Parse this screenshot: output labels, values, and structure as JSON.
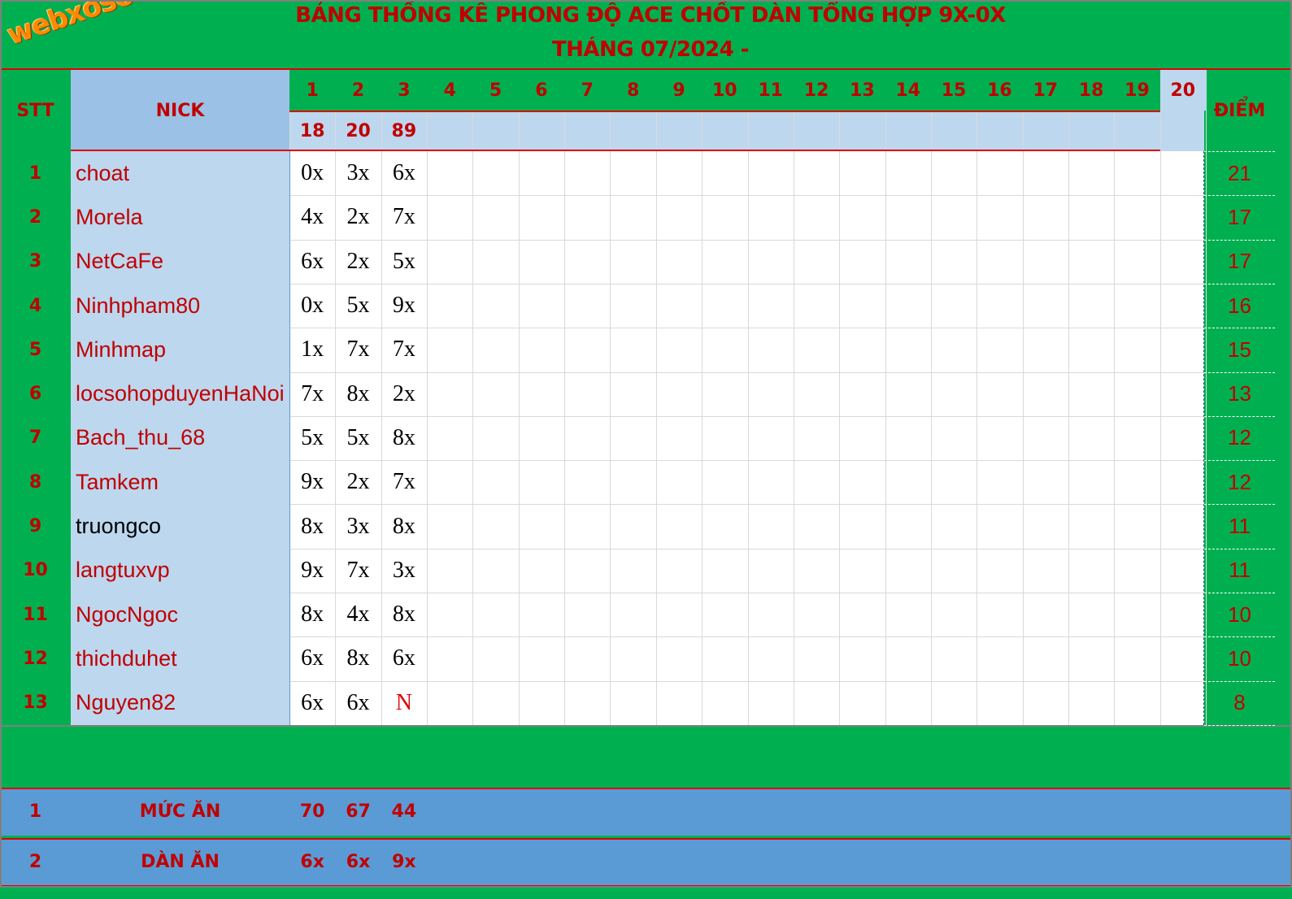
{
  "logo_text": "webxoso.net",
  "title_line1": "BẢNG THỐNG KÊ PHONG ĐỘ ACE CHỐT DÀN TỔNG HỢP 9X-0X",
  "title_line2": "THÁNG 07/2024 -",
  "headers": {
    "stt": "STT",
    "nick": "NICK",
    "score": "ĐIỂM"
  },
  "days": [
    "1",
    "2",
    "3",
    "4",
    "5",
    "6",
    "7",
    "8",
    "9",
    "10",
    "11",
    "12",
    "13",
    "14",
    "15",
    "16",
    "17",
    "18",
    "19",
    "20"
  ],
  "results": [
    "18",
    "20",
    "89"
  ],
  "rows": [
    {
      "stt": "1",
      "nick": "choat",
      "picks": [
        "0x",
        "3x",
        "6x"
      ],
      "score": "21",
      "nick_color": "#c00000"
    },
    {
      "stt": "2",
      "nick": "Morela",
      "picks": [
        "4x",
        "2x",
        "7x"
      ],
      "score": "17",
      "nick_color": "#c00000"
    },
    {
      "stt": "3",
      "nick": "NetCaFe",
      "picks": [
        "6x",
        "2x",
        "5x"
      ],
      "score": "17",
      "nick_color": "#c00000"
    },
    {
      "stt": "4",
      "nick": "Ninhpham80",
      "picks": [
        "0x",
        "5x",
        "9x"
      ],
      "score": "16",
      "nick_color": "#c00000"
    },
    {
      "stt": "5",
      "nick": "Minhmap",
      "picks": [
        "1x",
        "7x",
        "7x"
      ],
      "score": "15",
      "nick_color": "#c00000"
    },
    {
      "stt": "6",
      "nick": "locsohopduyenHaNoi",
      "picks": [
        "7x",
        "8x",
        "2x"
      ],
      "score": "13",
      "nick_color": "#c00000"
    },
    {
      "stt": "7",
      "nick": "Bach_thu_68",
      "picks": [
        "5x",
        "5x",
        "8x"
      ],
      "score": "12",
      "nick_color": "#c00000"
    },
    {
      "stt": "8",
      "nick": "Tamkem",
      "picks": [
        "9x",
        "2x",
        "7x"
      ],
      "score": "12",
      "nick_color": "#c00000"
    },
    {
      "stt": "9",
      "nick": "truongco",
      "picks": [
        "8x",
        "3x",
        "8x"
      ],
      "score": "11",
      "nick_color": "#000000"
    },
    {
      "stt": "10",
      "nick": "langtuxvp",
      "picks": [
        "9x",
        "7x",
        "3x"
      ],
      "score": "11",
      "nick_color": "#c00000"
    },
    {
      "stt": "11",
      "nick": "NgocNgoc",
      "picks": [
        "8x",
        "4x",
        "8x"
      ],
      "score": "10",
      "nick_color": "#c00000"
    },
    {
      "stt": "12",
      "nick": "thichduhet",
      "picks": [
        "6x",
        "8x",
        "6x"
      ],
      "score": "10",
      "nick_color": "#c00000"
    },
    {
      "stt": "13",
      "nick": "Nguyen82",
      "picks": [
        "6x",
        "6x",
        "N"
      ],
      "score": "8",
      "nick_color": "#c00000"
    }
  ],
  "summary": [
    {
      "stt": "1",
      "label": "MỨC ĂN",
      "values": [
        "70",
        "67",
        "44"
      ]
    },
    {
      "stt": "2",
      "label": "DÀN ĂN",
      "values": [
        "6x",
        "6x",
        "9x"
      ]
    }
  ],
  "colors": {
    "green": "#00b050",
    "light_blue": "#bdd7ee",
    "header_blue": "#9bc2e6",
    "summary_blue": "#5b9bd5",
    "red_text": "#c00000",
    "grid": "#d9d9d9"
  }
}
